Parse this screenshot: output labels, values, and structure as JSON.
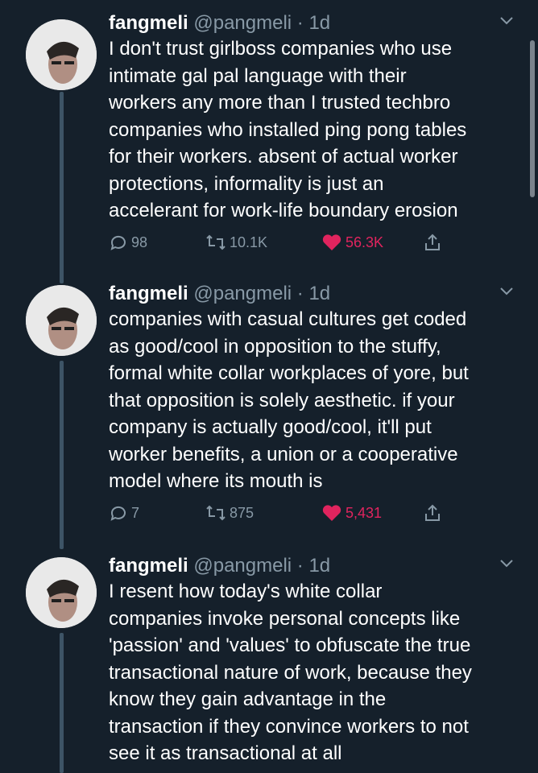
{
  "tweets": [
    {
      "name": "fangmeli",
      "meta": "@pangmeli · 1d",
      "lines": [
        "I don't trust girlboss companies who use",
        "intimate gal pal language with their",
        "workers any more than I trusted techbro",
        "companies who installed ping pong tables",
        "for their workers. absent of actual worker",
        "protections, informality is just an",
        "accelerant for work-life boundary erosion"
      ],
      "replies": "98",
      "retweets": "10.1K",
      "likes": "56.3K"
    },
    {
      "name": "fangmeli",
      "meta": "@pangmeli · 1d",
      "lines": [
        "companies with casual cultures get coded",
        "as good/cool in opposition to the stuffy,",
        "formal white collar workplaces of yore, but",
        "that opposition is solely aesthetic. if your",
        "company is actually good/cool, it'll put",
        "worker benefits, a union or a cooperative",
        "model where its mouth is"
      ],
      "replies": "7",
      "retweets": "875",
      "likes": "5,431"
    },
    {
      "name": "fangmeli",
      "meta": "@pangmeli · 1d",
      "lines": [
        "I resent how today's white collar",
        "companies invoke personal concepts like",
        "'passion' and 'values' to obfuscate the true",
        "transactional nature of work, because they",
        "know they gain advantage in the",
        "transaction if they convince workers to not",
        "see it as transactional at all"
      ]
    }
  ],
  "colors": {
    "background": "#15202b",
    "secondary_text": "#8899a6",
    "like": "#e0245e",
    "thread_line": "#3d5466"
  },
  "icons": {
    "reply": "reply-icon",
    "retweet": "retweet-icon",
    "like": "heart-icon",
    "share": "share-icon",
    "more": "chevron-down-icon"
  }
}
